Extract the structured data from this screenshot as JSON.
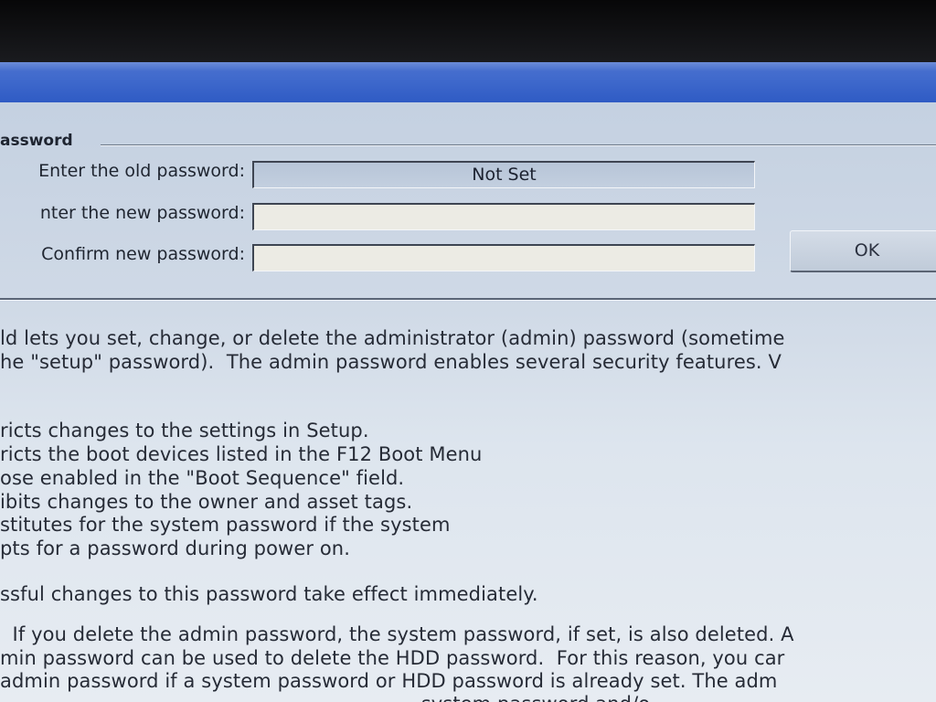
{
  "password_group": {
    "title": "assword",
    "old_label": "Enter the old password:",
    "old_value": "Not Set",
    "new_label": "nter the new password:",
    "new_value": "",
    "confirm_label": "Confirm new password:",
    "confirm_value": "",
    "ok_label": "OK"
  },
  "help_text": {
    "lines": [
      "ld lets you set, change, or delete the administrator (admin) password (sometime",
      "he \"setup\" password).  The admin password enables several security features. V",
      "ricts changes to the settings in Setup.",
      "ricts the boot devices listed in the F12 Boot Menu",
      "ose enabled in the \"Boot Sequence\" field.",
      "ibits changes to the owner and asset tags.",
      "stitutes for the system password if the system",
      "pts for a password during power on.",
      "ssful changes to this password take effect immediately.",
      "  If you delete the admin password, the system password, if set, is also deleted. A",
      "min password can be used to delete the HDD password.  For this reason, you car",
      "admin password if a system password or HDD password is already set. The adm",
      "                                                                    system password and/o"
    ]
  },
  "colors": {
    "titlebar": "#3f69cc",
    "panel": "#cfd9e6",
    "field_editable": "#ecebe4",
    "field_readonly": "#bccadb"
  }
}
